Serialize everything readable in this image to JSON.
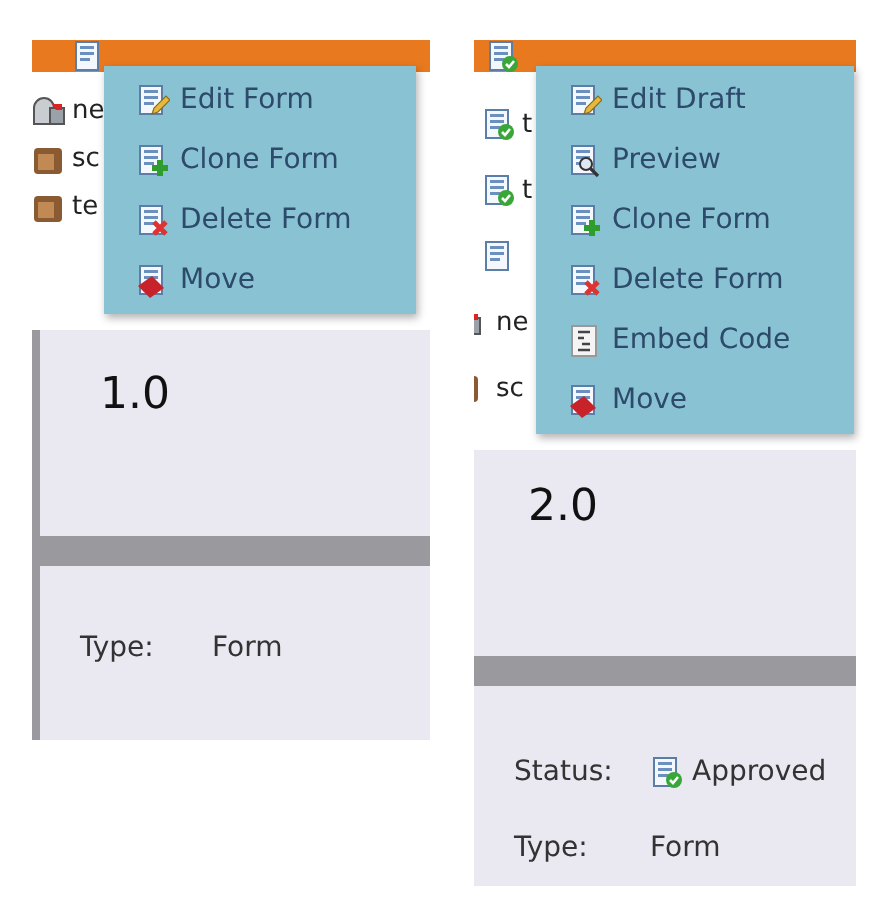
{
  "panels": [
    {
      "tree": [
        {
          "kind": "mailbox",
          "label": "ne"
        },
        {
          "kind": "folder",
          "label": "sc"
        },
        {
          "kind": "folder",
          "label": "te"
        }
      ],
      "menu": [
        {
          "kind": "edit",
          "label": "Edit Form"
        },
        {
          "kind": "clone",
          "label": "Clone Form"
        },
        {
          "kind": "delete",
          "label": "Delete Form"
        },
        {
          "kind": "move",
          "label": "Move"
        }
      ],
      "left_border": true,
      "title": "1.0",
      "details": [
        {
          "label": "Type:",
          "value": "Form"
        }
      ]
    },
    {
      "tree": [
        {
          "kind": "approved",
          "label": "t"
        },
        {
          "kind": "approved",
          "label": "t"
        },
        {
          "kind": "form"
        },
        {
          "kind": "mailbox",
          "label": "ne"
        },
        {
          "kind": "folder",
          "label": "sc"
        }
      ],
      "menu": [
        {
          "kind": "edit",
          "label": "Edit Draft"
        },
        {
          "kind": "preview",
          "label": "Preview"
        },
        {
          "kind": "clone",
          "label": "Clone Form"
        },
        {
          "kind": "delete",
          "label": "Delete Form"
        },
        {
          "kind": "embed",
          "label": "Embed Code"
        },
        {
          "kind": "move",
          "label": "Move"
        }
      ],
      "left_border": false,
      "title": "2.0",
      "details": [
        {
          "label": "Status:",
          "kind": "status",
          "value": "Approved"
        },
        {
          "label": "Type:",
          "value": "Form"
        }
      ]
    }
  ]
}
